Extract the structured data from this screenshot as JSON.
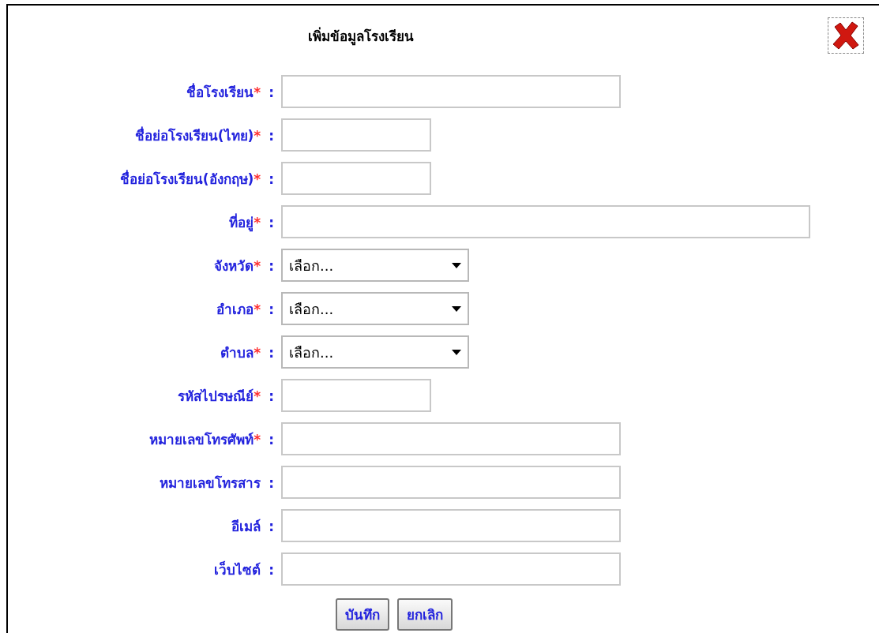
{
  "dialog": {
    "title": "เพิ่มข้อมูลโรงเรียน"
  },
  "fields": [
    {
      "label": "ชื่อโรงเรียน",
      "required_mark": "*",
      "colon": ":",
      "kind": "medium_text"
    },
    {
      "label": "ชื่อย่อโรงเรียน(ไทย)",
      "required_mark": "*",
      "colon": ":",
      "kind": "short_text"
    },
    {
      "label": "ชื่อย่อโรงเรียน(อังกฤษ)",
      "required_mark": "*",
      "colon": ":",
      "kind": "short_text"
    },
    {
      "label": "ที่อยู่",
      "required_mark": "*",
      "colon": ":",
      "kind": "long_text"
    },
    {
      "label": "จังหวัด",
      "required_mark": "*",
      "colon": ":",
      "kind": "select",
      "value": "เลือก..."
    },
    {
      "label": "อำเภอ",
      "required_mark": "*",
      "colon": ":",
      "kind": "select",
      "value": "เลือก..."
    },
    {
      "label": "ตำบล",
      "required_mark": "*",
      "colon": ":",
      "kind": "select",
      "value": "เลือก..."
    },
    {
      "label": "รหัสไปรษณีย์",
      "required_mark": "*",
      "colon": ":",
      "kind": "short_text"
    },
    {
      "label": "หมายเลขโทรศัพท์",
      "required_mark": "*",
      "colon": ":",
      "kind": "medium_text"
    },
    {
      "label": "หมายเลขโทรสาร",
      "colon": ":",
      "kind": "medium_text"
    },
    {
      "label": "อีเมล์",
      "colon": ":",
      "kind": "medium_text"
    },
    {
      "label": "เว็บไซต์",
      "colon": ":",
      "kind": "medium_text"
    }
  ],
  "buttons": [
    "บันทึก",
    "ยกเลิก"
  ]
}
